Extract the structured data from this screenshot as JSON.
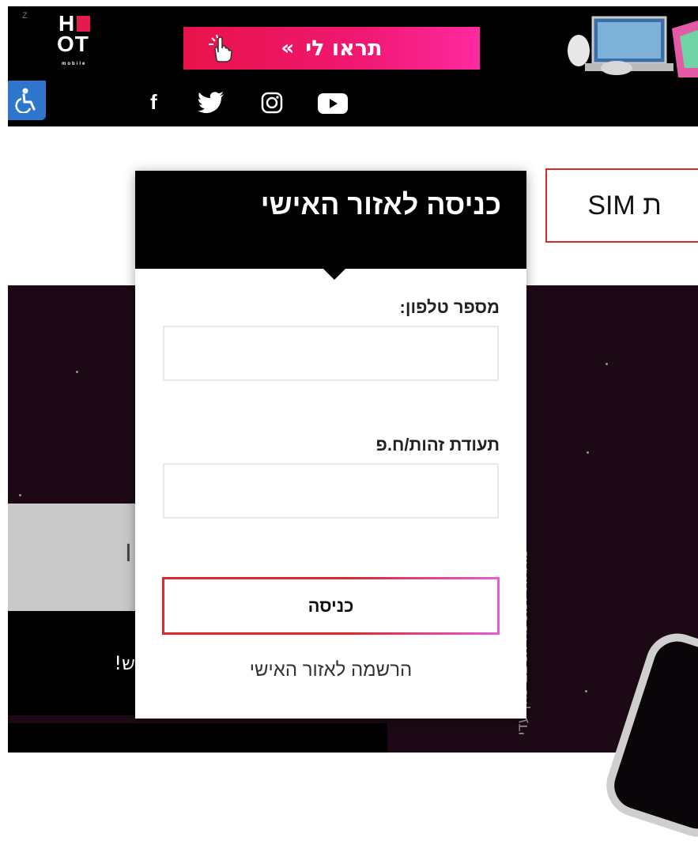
{
  "banner": {
    "z_mark": "Z",
    "logo_h": "H",
    "logo_ot": "OT",
    "logo_mobile": "mobile",
    "cta_label": "תראו לי",
    "cta_arrow": "«"
  },
  "social": {
    "icons": [
      "accessibility-icon",
      "facebook-icon",
      "twitter-icon",
      "instagram-icon",
      "youtube-icon"
    ],
    "facebook_glyph": "f"
  },
  "background": {
    "sim_tab_label": "ת SIM",
    "grey_band_char": "I",
    "black_band_text": "!ש",
    "vertical_caption": "מתחת למסכה הניצב כהן עדי"
  },
  "login": {
    "title": "כניסה לאזור האישי",
    "phone_label": "מספר טלפון:",
    "phone_value": "",
    "id_label": "תעודת זהות/ח.פ",
    "id_value": "",
    "submit_label": "כניסה",
    "register_link": "הרשמה לאזור האישי"
  },
  "colors": {
    "accent_red": "#e0252d",
    "cta_pink": "#f01872",
    "accessibility_blue": "#2d76c9"
  }
}
